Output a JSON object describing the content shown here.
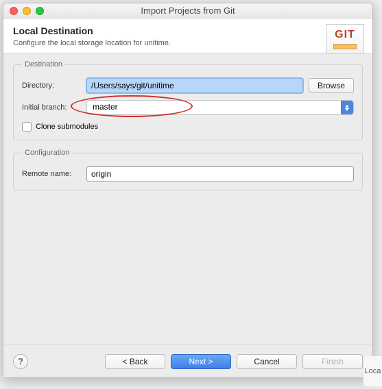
{
  "window": {
    "title": "Import Projects from Git"
  },
  "header": {
    "heading": "Local Destination",
    "subtitle": "Configure the local storage location for unitime.",
    "logo_text": "GIT"
  },
  "destination": {
    "legend": "Destination",
    "directory_label": "Directory:",
    "directory_value": "/Users/says/git/unitime",
    "browse_label": "Browse",
    "initial_branch_label": "Initial branch:",
    "initial_branch_value": "master",
    "clone_submodules_label": "Clone submodules"
  },
  "configuration": {
    "legend": "Configuration",
    "remote_name_label": "Remote name:",
    "remote_name_value": "origin"
  },
  "footer": {
    "back": "< Back",
    "next": "Next >",
    "cancel": "Cancel",
    "finish": "Finish"
  },
  "bg": {
    "fragment": "Loca"
  }
}
